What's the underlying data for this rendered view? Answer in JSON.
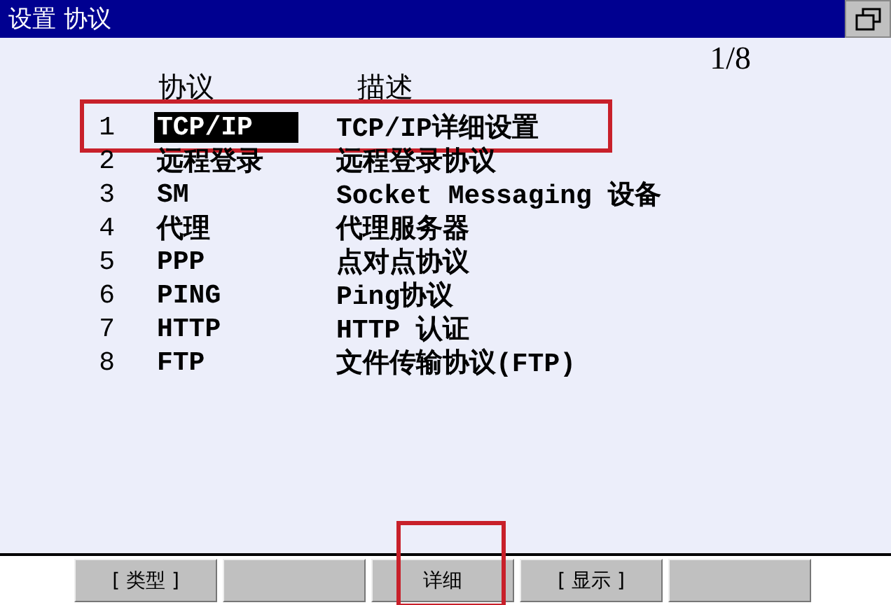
{
  "window": {
    "title": "设置 协议"
  },
  "page_indicator": "1/8",
  "table": {
    "columns": [
      "协议",
      "描述"
    ],
    "rows": [
      {
        "number": "1",
        "protocol": "TCP/IP",
        "description": "TCP/IP详细设置",
        "selected": true,
        "annotated": true
      },
      {
        "number": "2",
        "protocol": "远程登录",
        "description": "远程登录协议",
        "selected": false,
        "annotated": false
      },
      {
        "number": "3",
        "protocol": "SM",
        "description": "Socket Messaging 设备",
        "selected": false,
        "annotated": false
      },
      {
        "number": "4",
        "protocol": "代理",
        "description": "代理服务器",
        "selected": false,
        "annotated": false
      },
      {
        "number": "5",
        "protocol": "PPP",
        "description": "点对点协议",
        "selected": false,
        "annotated": false
      },
      {
        "number": "6",
        "protocol": "PING",
        "description": "Ping协议",
        "selected": false,
        "annotated": false
      },
      {
        "number": "7",
        "protocol": "HTTP",
        "description": "HTTP 认证",
        "selected": false,
        "annotated": false
      },
      {
        "number": "8",
        "protocol": "FTP",
        "description": "文件传输协议(FTP)",
        "selected": false,
        "annotated": false
      }
    ]
  },
  "function_keys": [
    {
      "label": "[ 类型 ]",
      "annotated": false
    },
    {
      "annotated": false
    },
    {
      "label": "详细",
      "annotated": true
    },
    {
      "label": "[ 显示 ]",
      "annotated": false
    },
    {
      "annotated": false
    }
  ]
}
